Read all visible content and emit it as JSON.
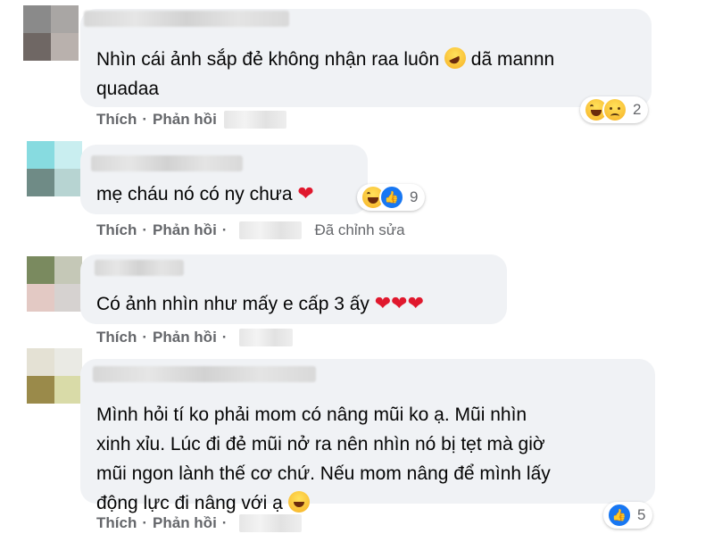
{
  "comments": [
    {
      "text": "Nhìn cái ảnh sắp đẻ không nhận raa luôn 🤣 dã mannn quadaa",
      "like_label": "Thích",
      "reply_label": "Phản hồi",
      "reaction_count": "2"
    },
    {
      "text": "mẹ cháu nó có ny chưa ❤️",
      "like_label": "Thích",
      "reply_label": "Phản hồi",
      "edited_label": "Đã chỉnh sửa",
      "reaction_count": "9"
    },
    {
      "text": "Có ảnh nhìn như mấy e cấp 3 ấy ❤️❤️❤️",
      "like_label": "Thích",
      "reply_label": "Phản hồi"
    },
    {
      "text": "Mình hỏi tí ko phải mom có nâng mũi ko ạ. Mũi nhìn xinh xỉu. Lúc đi đẻ mũi nở ra nên nhìn nó bị tẹt mà giờ mũi ngon lành thế cơ chứ. Nếu mom nâng để mình lấy động lực đi nâng với ạ 😅",
      "like_label": "Thích",
      "reply_label": "Phản hồi",
      "reaction_count": "5"
    }
  ],
  "separator": "·",
  "colors": {
    "bubble": "#f0f2f5",
    "action_text": "#65676b",
    "like_blue": "#1877f2",
    "heart_red": "#e0182d"
  },
  "icons": [
    "haha-reaction-icon",
    "sad-reaction-icon",
    "like-reaction-icon",
    "heart-emoji"
  ]
}
